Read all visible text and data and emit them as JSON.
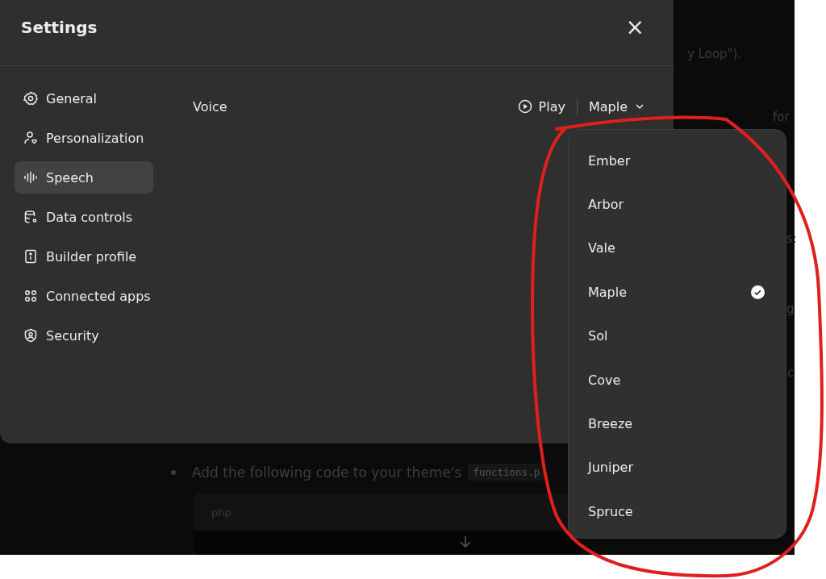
{
  "background": {
    "fragments": [
      {
        "text": "y Loop\")."
      },
      {
        "text": "for"
      },
      {
        "text": "s:"
      },
      {
        "text": "g"
      },
      {
        "text": "c"
      }
    ],
    "bullet": {
      "text": "Add the following code to your theme's",
      "code": "functions.p"
    },
    "code_block": {
      "language": "php"
    }
  },
  "dialog": {
    "title": "Settings",
    "close": "×"
  },
  "sidebar": {
    "items": [
      {
        "label": "General",
        "selected": false
      },
      {
        "label": "Personalization",
        "selected": false
      },
      {
        "label": "Speech",
        "selected": true
      },
      {
        "label": "Data controls",
        "selected": false
      },
      {
        "label": "Builder profile",
        "selected": false
      },
      {
        "label": "Connected apps",
        "selected": false
      },
      {
        "label": "Security",
        "selected": false
      }
    ]
  },
  "voice": {
    "label": "Voice",
    "play": "Play",
    "value": "Maple"
  },
  "dropdown": {
    "options": [
      {
        "label": "Ember",
        "selected": false
      },
      {
        "label": "Arbor",
        "selected": false
      },
      {
        "label": "Vale",
        "selected": false
      },
      {
        "label": "Maple",
        "selected": true
      },
      {
        "label": "Sol",
        "selected": false
      },
      {
        "label": "Cove",
        "selected": false
      },
      {
        "label": "Breeze",
        "selected": false
      },
      {
        "label": "Juniper",
        "selected": false
      },
      {
        "label": "Spruce",
        "selected": false
      }
    ]
  }
}
